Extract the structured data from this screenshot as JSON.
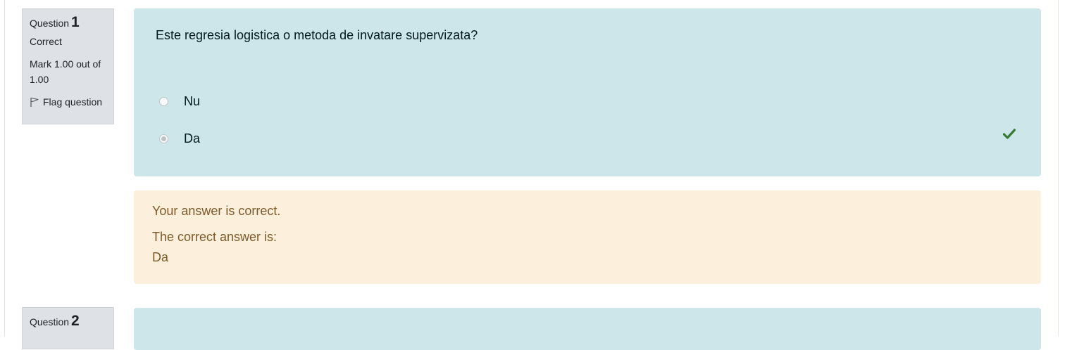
{
  "questions": [
    {
      "label": "Question",
      "number": "1",
      "state": "Correct",
      "mark": "Mark 1.00 out of 1.00",
      "flag_label": "Flag question",
      "text": "Este regresia logistica o metoda de invatare supervizata?",
      "answers": [
        {
          "label": "Nu",
          "selected": false
        },
        {
          "label": "Da",
          "selected": true
        }
      ],
      "feedback": {
        "result": "Your answer is correct.",
        "correct_intro": "The correct answer is:",
        "correct_value": "Da"
      }
    },
    {
      "label": "Question",
      "number": "2"
    }
  ],
  "colors": {
    "info_bg": "#dee2e6",
    "formulation_bg": "#cce6ea",
    "outcome_bg": "#fcefdc",
    "correct_tick": "#357a32"
  },
  "icons": {
    "flag": "flag-icon",
    "correct": "check-icon"
  }
}
